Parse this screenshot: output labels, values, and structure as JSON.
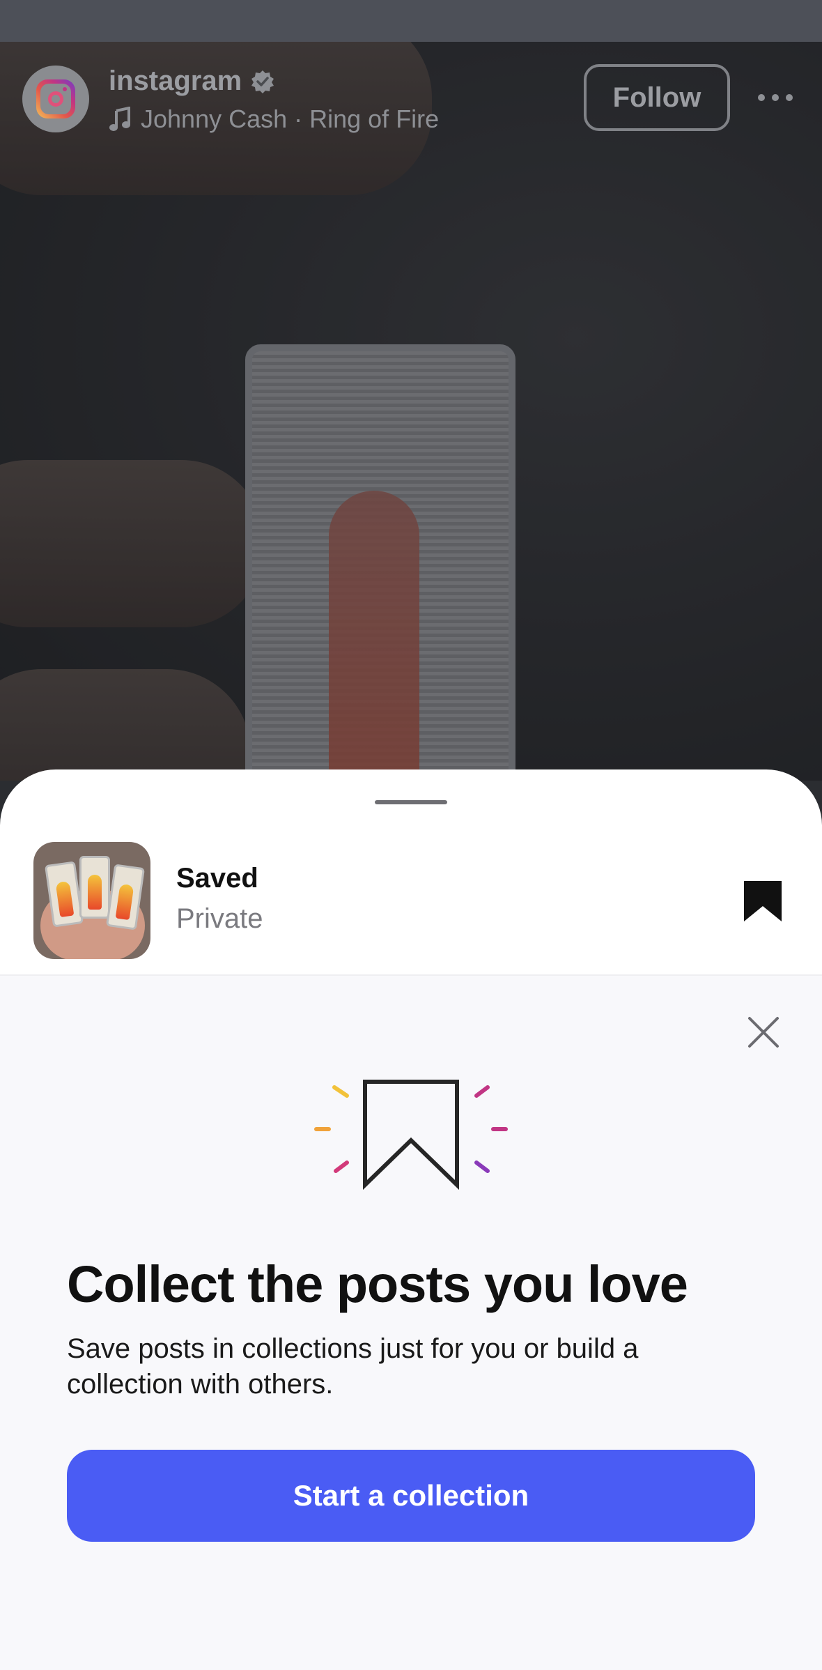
{
  "post": {
    "username": "instagram",
    "audio": "Johnny Cash · Ring of Fire",
    "follow_label": "Follow"
  },
  "saved": {
    "title": "Saved",
    "subtitle": "Private"
  },
  "promo": {
    "title": "Collect the posts you love",
    "body": "Save posts in collections just for you or build a collection with others.",
    "button_label": "Start a collection"
  },
  "colors": {
    "accent": "#4a5cf4",
    "sheet_background": "#ffffff",
    "promo_background": "#f8f8fb"
  },
  "icons": {
    "avatar": "instagram-logo-icon",
    "verified": "verified-badge-icon",
    "music": "music-note-icon",
    "more": "more-horizontal-icon",
    "bookmark": "bookmark-filled-icon",
    "close": "close-icon",
    "hero": "bookmark-sparkle-icon"
  }
}
